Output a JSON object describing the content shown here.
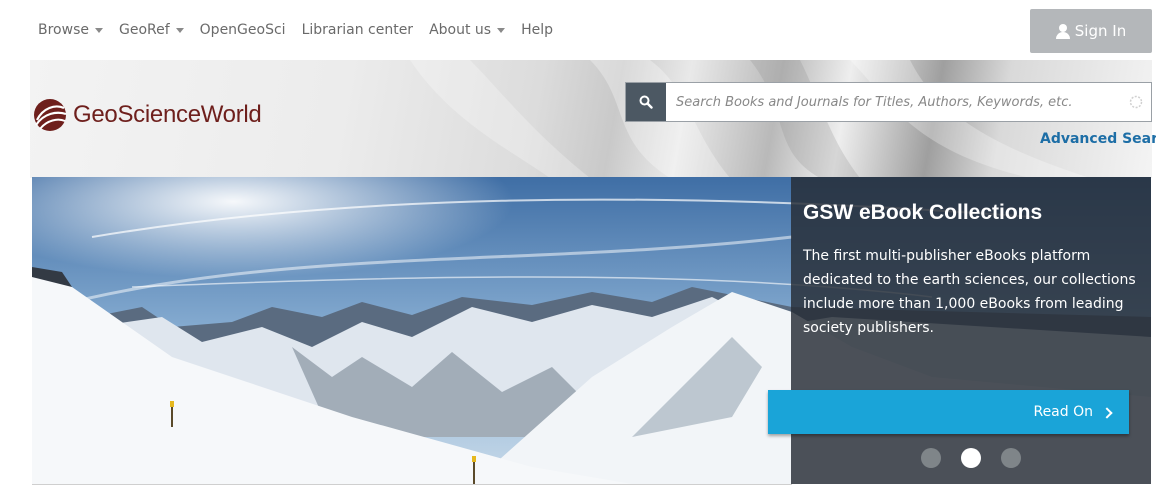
{
  "nav": {
    "items": [
      {
        "label": "Browse",
        "dropdown": true
      },
      {
        "label": "GeoRef",
        "dropdown": true
      },
      {
        "label": "OpenGeoSci",
        "dropdown": false
      },
      {
        "label": "Librarian center",
        "dropdown": false
      },
      {
        "label": "About us",
        "dropdown": true
      },
      {
        "label": "Help",
        "dropdown": false
      }
    ],
    "sign_in": "Sign In"
  },
  "header": {
    "logo_text": "GeoScienceWorld",
    "brand_color": "#6e1f1c",
    "search_placeholder": "Search Books and Journals for Titles, Authors, Keywords, etc.",
    "advanced_search": "Advanced Search"
  },
  "hero": {
    "title": "GSW eBook Collections",
    "text": "The first multi-publisher eBooks platform dedicated to the earth sciences, our collections include more than 1,000 eBooks from leading society publishers.",
    "cta": "Read On",
    "cta_color": "#1aa4d8",
    "slides": 3,
    "active_slide": 2
  },
  "icons": {
    "search": "search-icon",
    "user": "user-icon",
    "spinner": "loading-icon",
    "chevron": "chevron-right-icon",
    "dropdown": "caret-down-icon"
  }
}
